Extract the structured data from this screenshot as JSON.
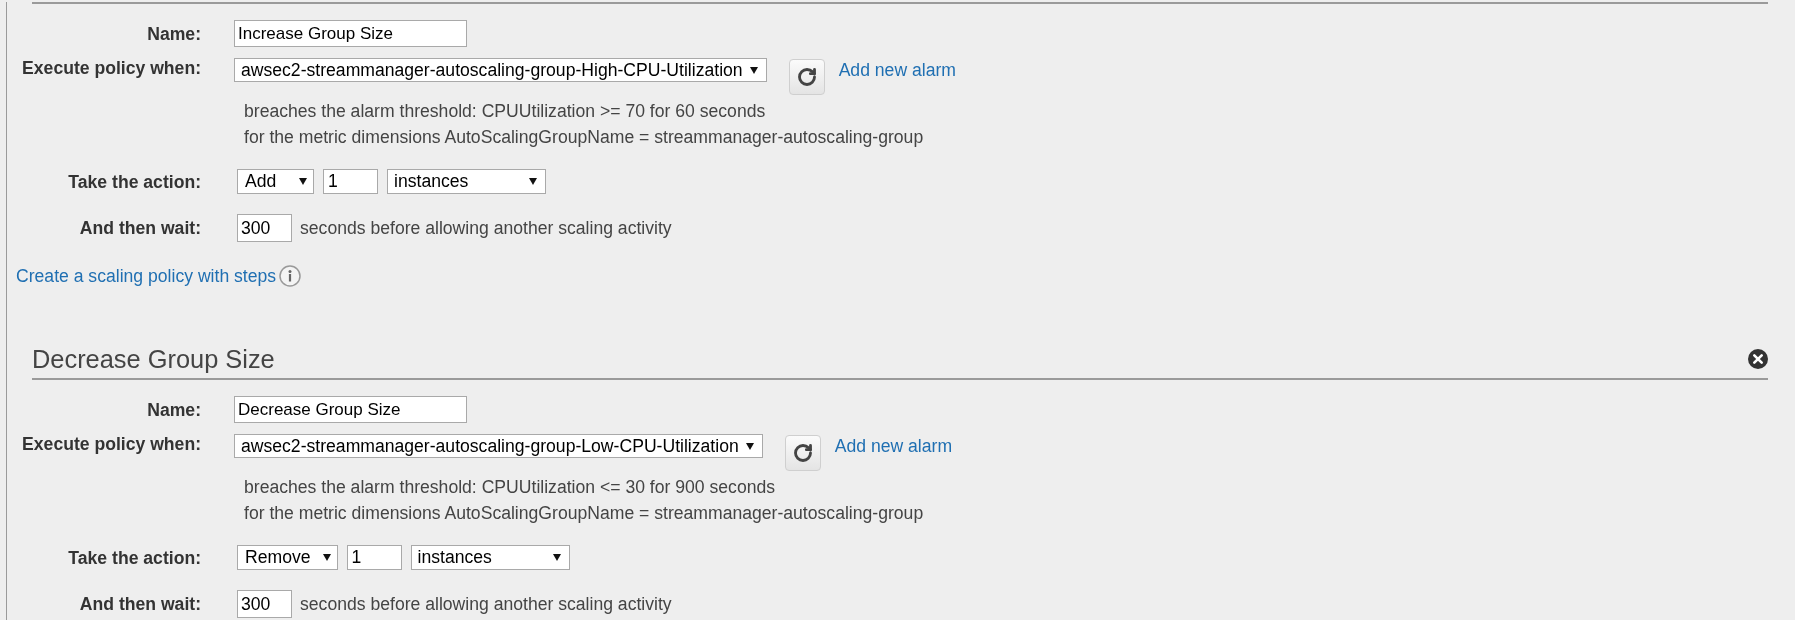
{
  "policies": [
    {
      "name_label": "Name:",
      "name": "Increase Group Size",
      "alarm_label": "Execute policy when:",
      "alarm": "awsec2-streammanager-autoscaling-group-High-CPU-Utilization",
      "add_alarm": "Add new alarm",
      "threshold": "breaches the alarm threshold: CPUUtilization >= 70 for 60 seconds",
      "dimensions": "for the metric dimensions AutoScalingGroupName = streammanager-autoscaling-group",
      "action_label": "Take the action:",
      "action": "Add",
      "amount": "1",
      "unit": "instances",
      "wait_label": "And then wait:",
      "wait": "300",
      "wait_text": "seconds before allowing another scaling activity",
      "steps_link": "Create a scaling policy with steps"
    },
    {
      "title": "Decrease Group Size",
      "name_label": "Name:",
      "name": "Decrease Group Size",
      "alarm_label": "Execute policy when:",
      "alarm": "awsec2-streammanager-autoscaling-group-Low-CPU-Utilization",
      "add_alarm": "Add new alarm",
      "threshold": "breaches the alarm threshold: CPUUtilization <= 30 for 900 seconds",
      "dimensions": "for the metric dimensions AutoScalingGroupName = streammanager-autoscaling-group",
      "action_label": "Take the action:",
      "action": "Remove",
      "amount": "1",
      "unit": "instances",
      "wait_label": "And then wait:",
      "wait": "300",
      "wait_text": "seconds before allowing another scaling activity"
    }
  ]
}
